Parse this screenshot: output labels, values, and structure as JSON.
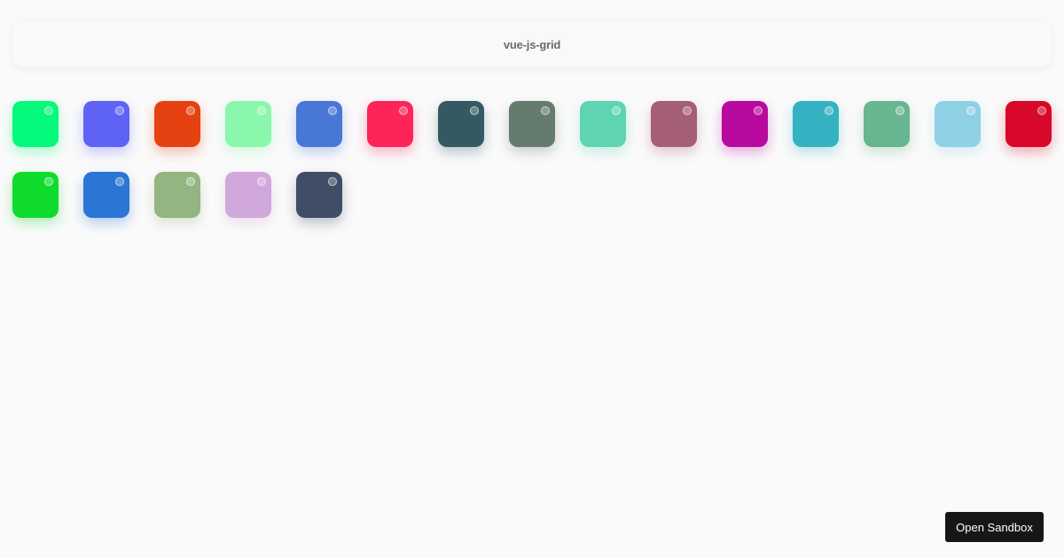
{
  "header": {
    "title": "vue-js-grid"
  },
  "grid": {
    "tiles": [
      {
        "color": "#05f97a"
      },
      {
        "color": "#5e63f6"
      },
      {
        "color": "#e64211"
      },
      {
        "color": "#8af7ac"
      },
      {
        "color": "#4877d6"
      },
      {
        "color": "#fc2459"
      },
      {
        "color": "#345963"
      },
      {
        "color": "#657b6e"
      },
      {
        "color": "#5ed4b3"
      },
      {
        "color": "#a45e78"
      },
      {
        "color": "#b80a9f"
      },
      {
        "color": "#34b2c1"
      },
      {
        "color": "#67b68f"
      },
      {
        "color": "#8ed1e6"
      },
      {
        "color": "#d70829"
      },
      {
        "color": "#0fdb2c"
      },
      {
        "color": "#2b75d4"
      },
      {
        "color": "#93b582"
      },
      {
        "color": "#d1a8db"
      },
      {
        "color": "#3f4d66"
      }
    ]
  },
  "actions": {
    "open_sandbox_label": "Open Sandbox"
  }
}
